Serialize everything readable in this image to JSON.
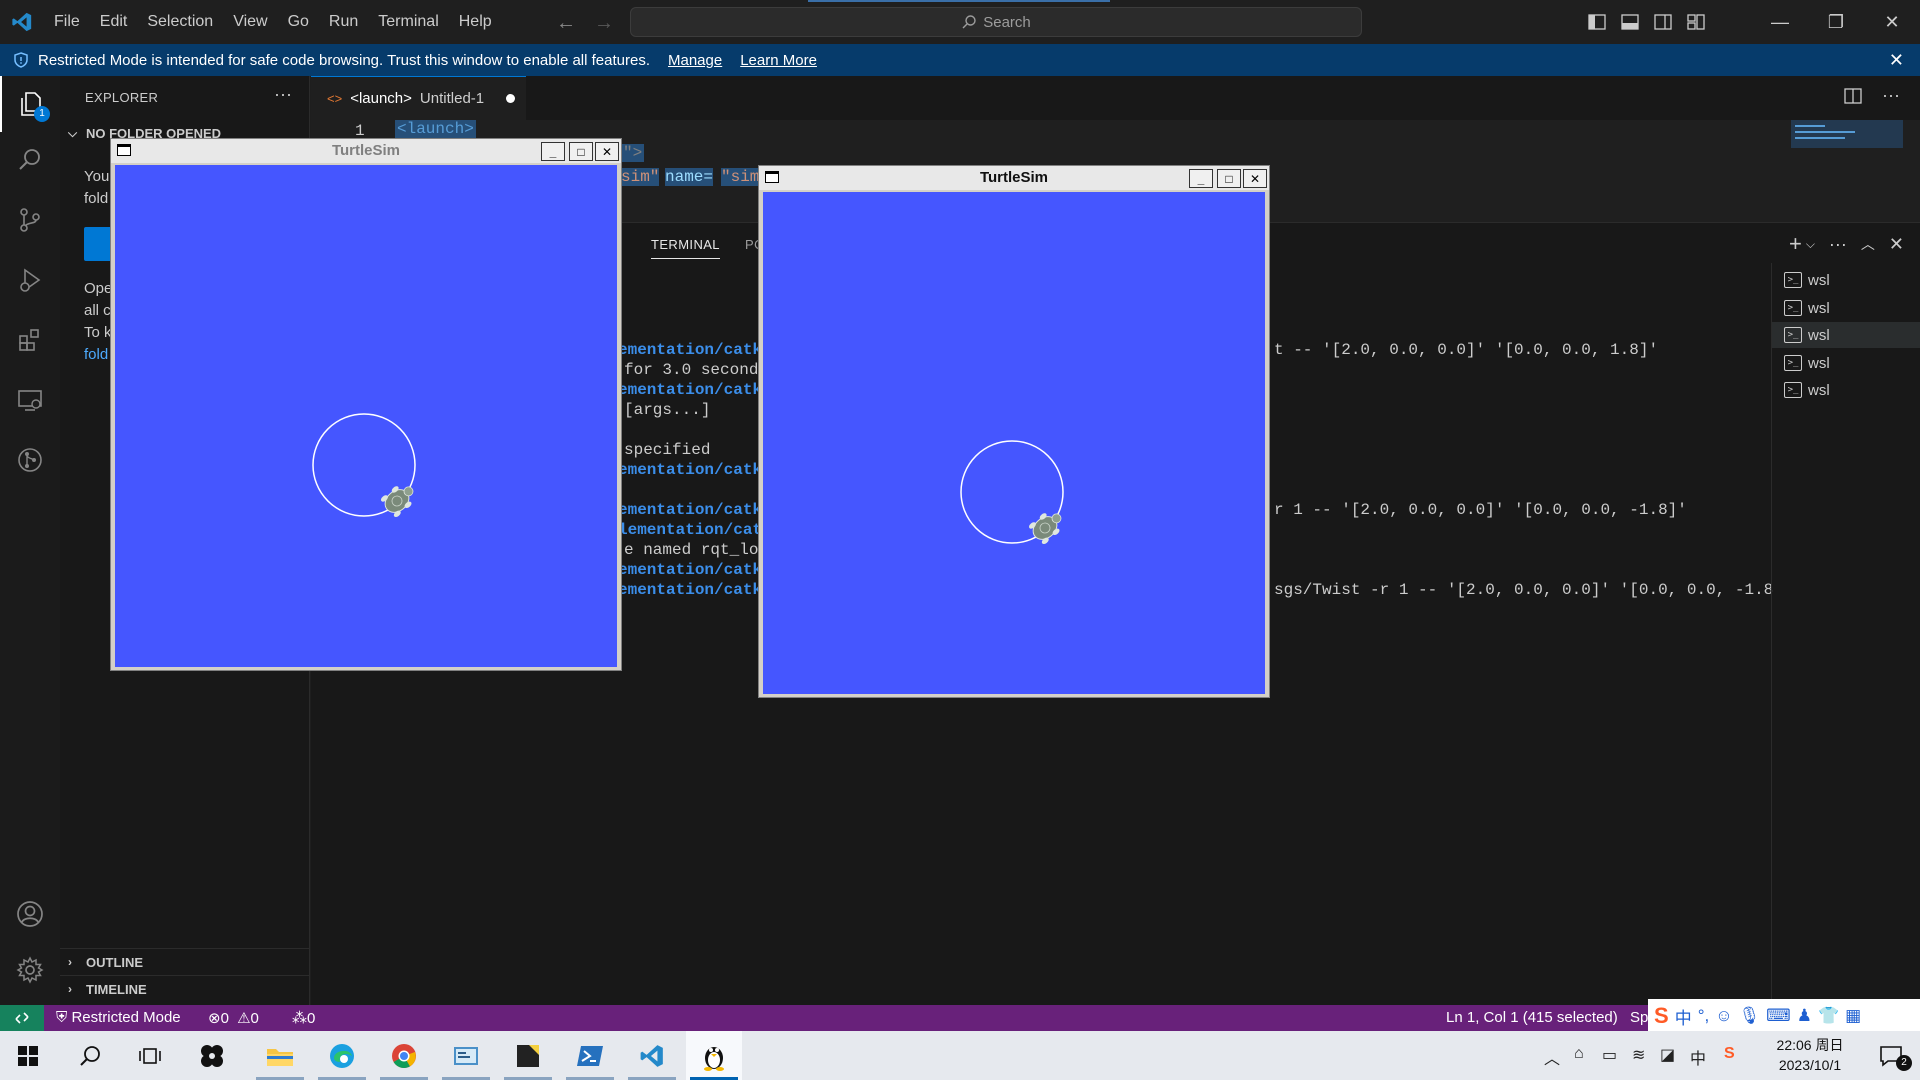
{
  "titlebar": {
    "menu": [
      "File",
      "Edit",
      "Selection",
      "View",
      "Go",
      "Run",
      "Terminal",
      "Help"
    ],
    "search_label": "Search"
  },
  "banner": {
    "message": "Restricted Mode is intended for safe code browsing. Trust this window to enable all features.",
    "manage": "Manage",
    "learn_more": "Learn More"
  },
  "activitybar": {
    "explorer_badge": "1"
  },
  "sidebar": {
    "title": "EXPLORER",
    "more": "···",
    "section": "NO FOLDER OPENED",
    "line1": "You",
    "line2": "fold",
    "line3": "Ope",
    "line4": "all c",
    "line5": "To k",
    "line6": "fold",
    "outline": "OUTLINE",
    "timeline": "TIMELINE"
  },
  "editor": {
    "tab_icon": "<>",
    "tab_name": "<launch>",
    "tab_desc": "Untitled-1",
    "line_number": "1",
    "line1_code": "<launch>",
    "line2_code": "\">",
    "line3_attr1": "sim\"",
    "line3_attr2": "name=",
    "line3_val": "\"sim"
  },
  "panel": {
    "tab_terminal": "TERMINAL",
    "tab_partial": "PO",
    "lines": [
      {
        "text": "ementation/catki",
        "kind": "path"
      },
      {
        "text": "for 3.0 seconds",
        "kind": "text"
      },
      {
        "text": "ementation/catki",
        "kind": "path"
      },
      {
        "text": "[args...]",
        "kind": "text"
      },
      {
        "text": "specified",
        "kind": "text"
      },
      {
        "text": "ementation/catki",
        "kind": "path"
      },
      {
        "text": "ementation/catki",
        "kind": "path"
      },
      {
        "text": "lementation/cat",
        "kind": "path"
      },
      {
        "text": "e named rqt_log",
        "kind": "text"
      },
      {
        "text": "ementation/catki",
        "kind": "path"
      },
      {
        "text": "ementation/catki",
        "kind": "path"
      }
    ],
    "right_lines": [
      "t -- '[2.0, 0.0, 0.0]' '[0.0, 0.0, 1.8]'",
      "r 1 -- '[2.0, 0.0, 0.0]' '[0.0, 0.0, -1.8]'",
      "sgs/Twist -r 1 -- '[2.0, 0.0, 0.0]' '[0.0, 0.0, -1.8"
    ],
    "terminals": [
      "wsl",
      "wsl",
      "wsl",
      "wsl",
      "wsl"
    ],
    "active_terminal_index": 2
  },
  "turtlesim_left": {
    "title": "TurtleSim"
  },
  "turtlesim_right": {
    "title": "TurtleSim"
  },
  "statusbar": {
    "mode": "Restricted Mode",
    "errors": "0",
    "warnings": "0",
    "ports": "0",
    "cursor": "Ln 1, Col 1 (415 selected)",
    "spaces": "Sp"
  },
  "taskbar": {
    "time": "22:06 周日",
    "date": "2023/10/1",
    "notifications": "2"
  },
  "colors": {
    "turtlesim_bg": "#4556ff",
    "statusbar_bg": "#68217a",
    "banner_bg": "#063b6b"
  }
}
